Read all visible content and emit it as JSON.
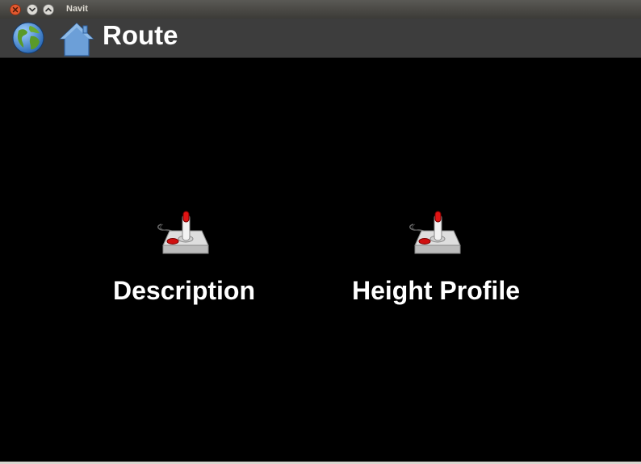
{
  "window": {
    "title": "Navit"
  },
  "header": {
    "title": "Route"
  },
  "icons": {
    "globe": "globe-icon",
    "home": "home-icon",
    "item": "joystick-icon"
  },
  "menu": {
    "items": [
      {
        "label": "Description"
      },
      {
        "label": "Height Profile"
      }
    ]
  },
  "colors": {
    "background": "#000000",
    "header": "#3d3d3d",
    "text": "#ffffff",
    "close": "#e1582f"
  }
}
